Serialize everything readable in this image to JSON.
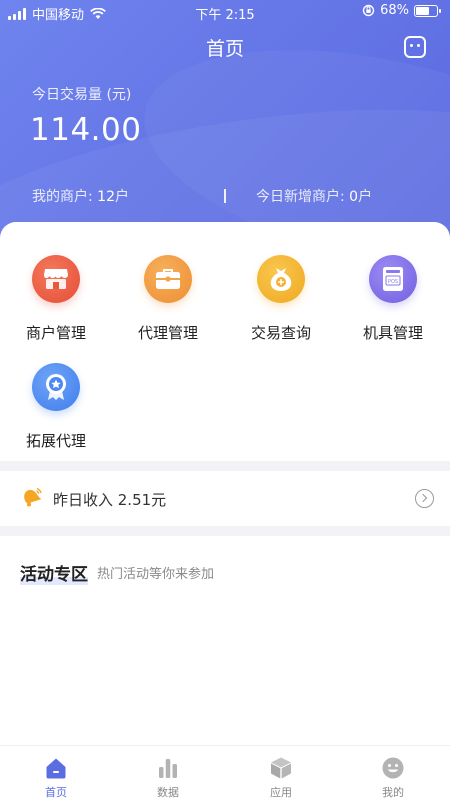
{
  "status_bar": {
    "carrier": "中国移动",
    "time": "下午 2:15",
    "battery": "68%",
    "battery_level": 0.68
  },
  "navbar": {
    "title": "首页",
    "message_icon": "chat-bubble-icon"
  },
  "summary": {
    "trade_label": "今日交易量 (元)",
    "trade_value": "114.00",
    "merchants_label": "我的商户: ",
    "merchants_value": "12",
    "merchants_unit": "户",
    "new_merchants_label": "今日新增商户: ",
    "new_merchants_value": "0",
    "new_merchants_unit": "户"
  },
  "menu": [
    {
      "label": "商户管理",
      "icon": "store-icon",
      "color": "#e44d38"
    },
    {
      "label": "代理管理",
      "icon": "briefcase-icon",
      "color": "#ee8e32"
    },
    {
      "label": "交易查询",
      "icon": "money-bag-icon",
      "color": "#f0a821"
    },
    {
      "label": "机具管理",
      "icon": "pos-terminal-icon",
      "color": "#6f5fe0"
    },
    {
      "label": "拓展代理",
      "icon": "badge-star-icon",
      "color": "#3f7ded"
    }
  ],
  "income": {
    "text": "昨日收入 2.51元",
    "icon": "bell-icon"
  },
  "activity": {
    "title": "活动专区",
    "subtitle": "热门活动等你来参加"
  },
  "tabbar": [
    {
      "label": "首页",
      "icon": "home-icon",
      "active": true
    },
    {
      "label": "数据",
      "icon": "bar-chart-icon",
      "active": false
    },
    {
      "label": "应用",
      "icon": "cube-icon",
      "active": false
    },
    {
      "label": "我的",
      "icon": "smiley-icon",
      "active": false
    }
  ],
  "colors": {
    "accent": "#5b6ee1",
    "header_start": "#6f84ee",
    "header_end": "#5a6ae0"
  }
}
